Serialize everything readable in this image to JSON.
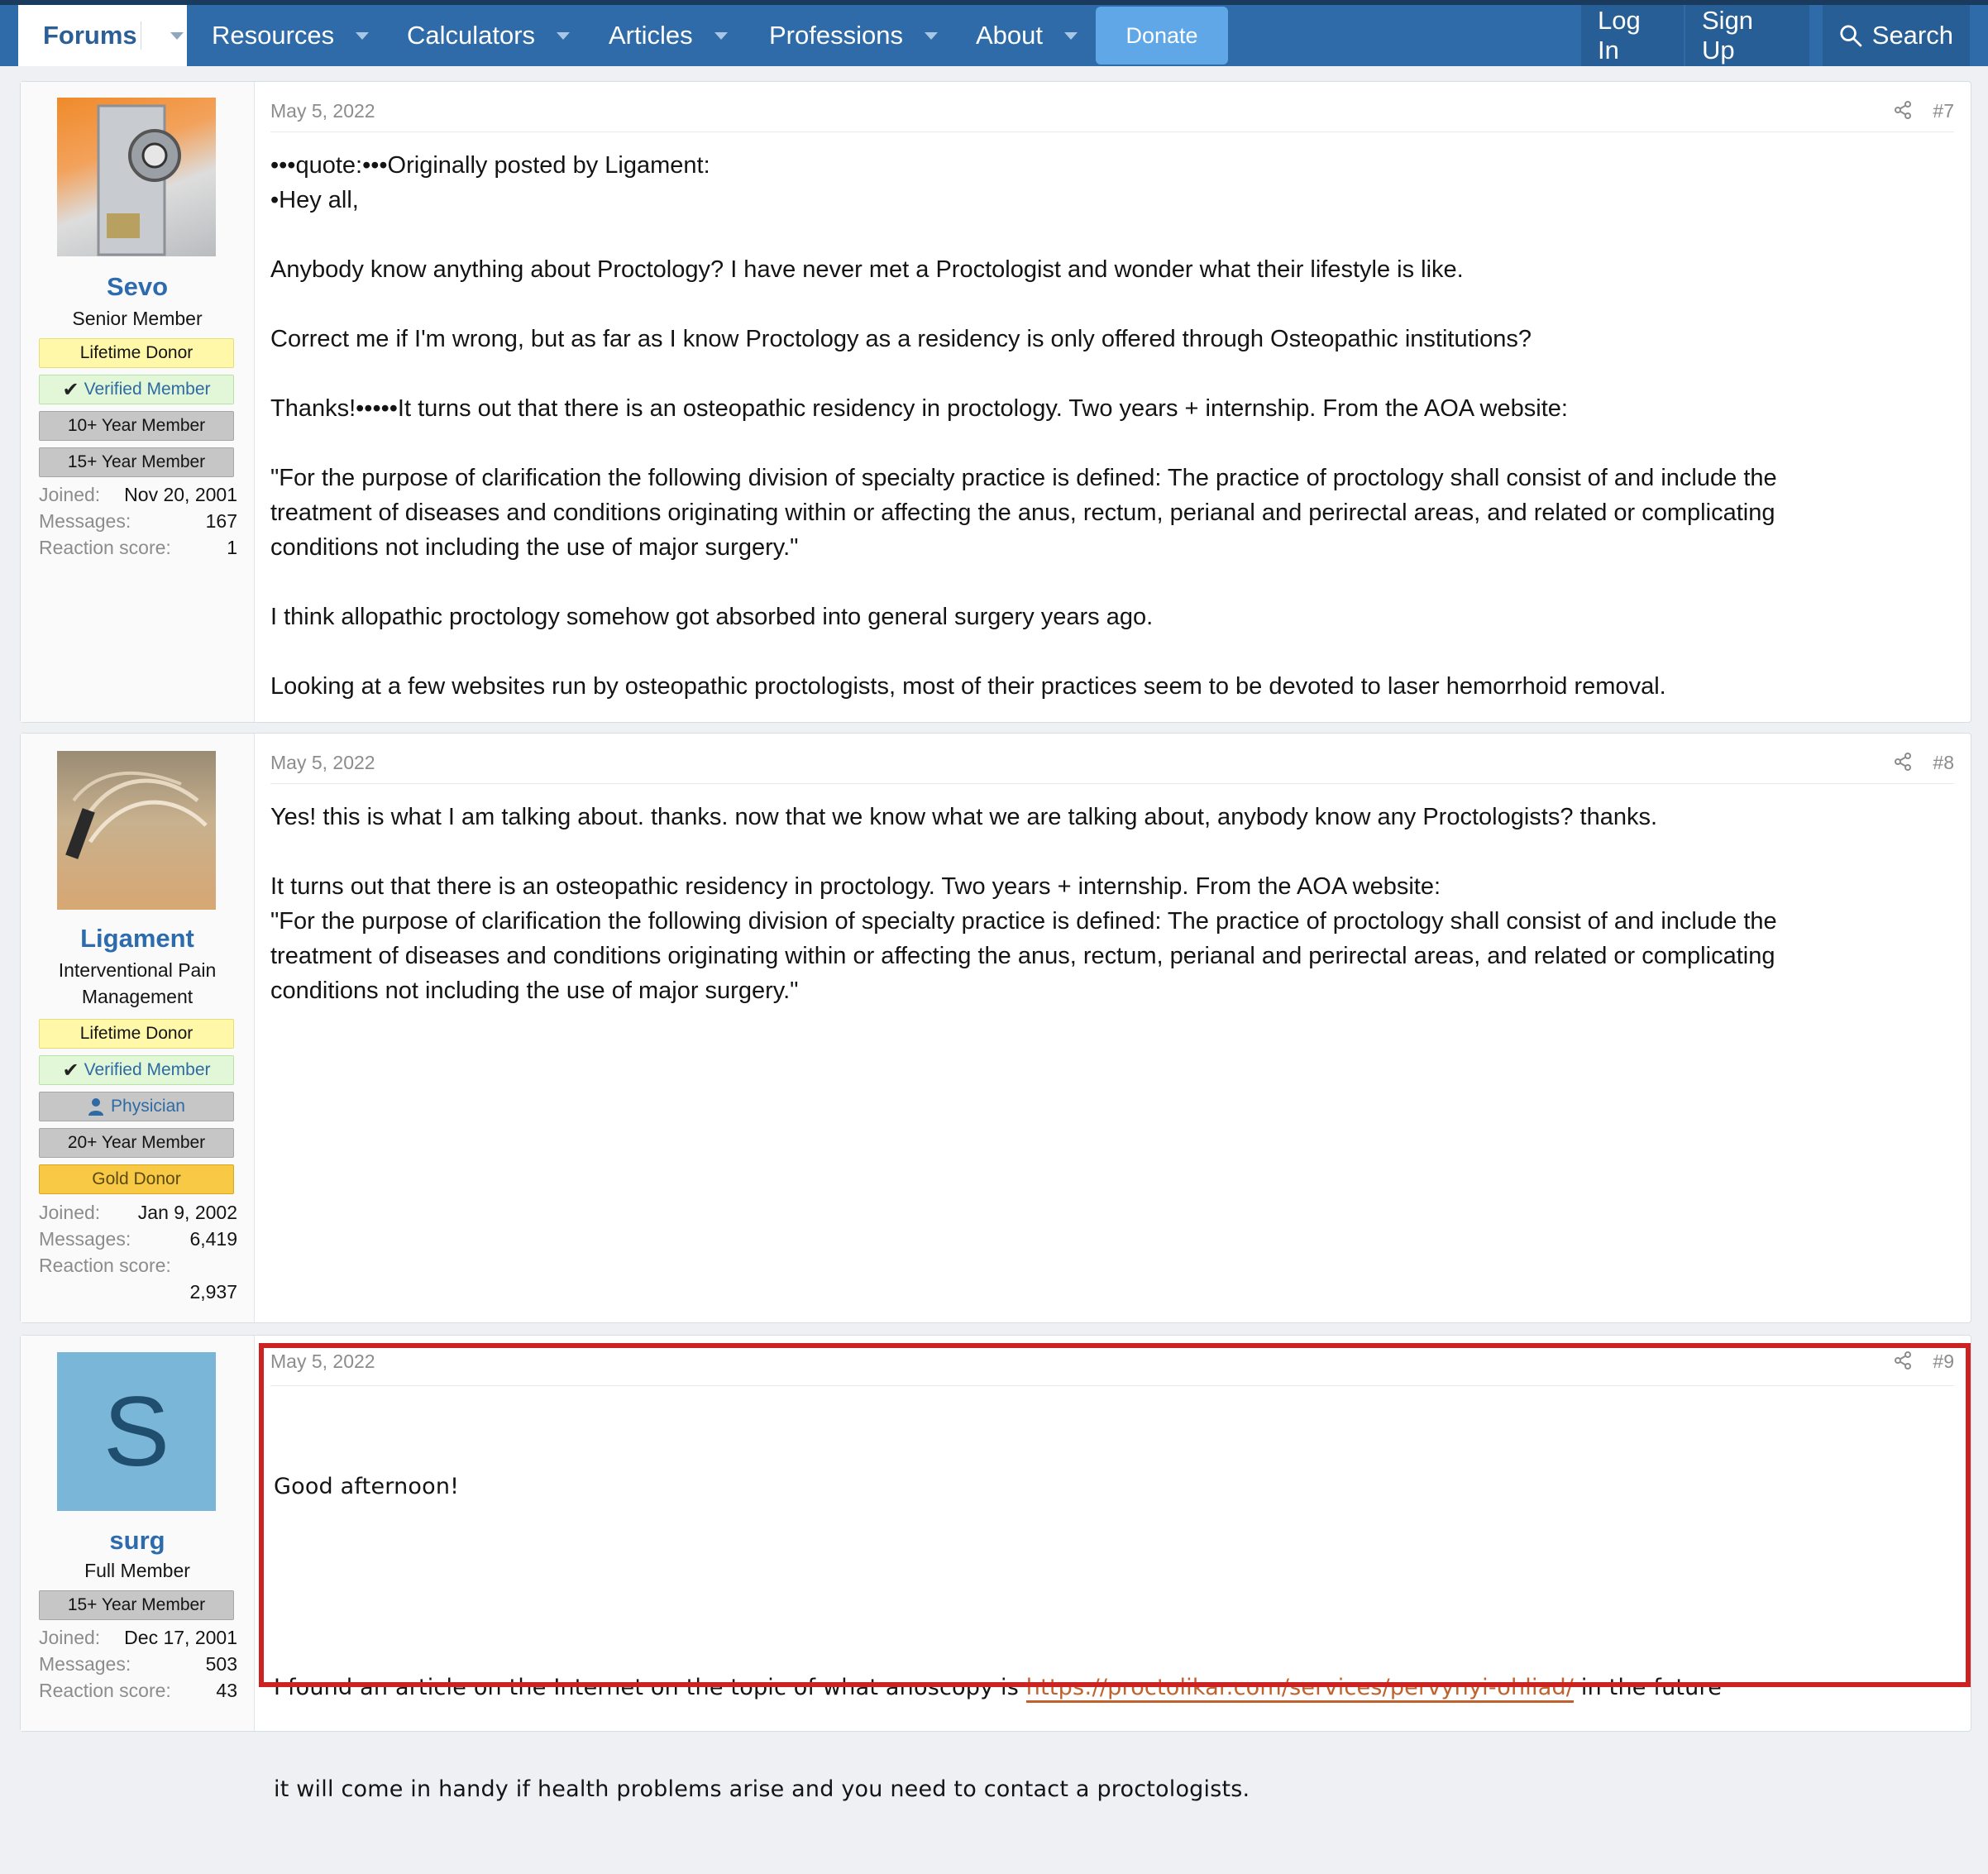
{
  "nav": {
    "forums": "Forums",
    "resources": "Resources",
    "calculators": "Calculators",
    "articles": "Articles",
    "professions": "Professions",
    "about": "About",
    "donate": "Donate",
    "login": "Log In",
    "signup": "Sign Up",
    "search": "Search"
  },
  "posts": [
    {
      "user": {
        "name": "Sevo",
        "title": "Senior Member",
        "badges": [
          "Lifetime Donor",
          "Verified Member",
          "10+ Year Member",
          "15+ Year Member"
        ],
        "joined_label": "Joined:",
        "joined": "Nov 20, 2001",
        "messages_label": "Messages:",
        "messages": "167",
        "reaction_label": "Reaction score:",
        "reaction": "1"
      },
      "date": "May 5, 2022",
      "number": "#7",
      "body": "•••quote:•••Originally posted by Ligament:\n•Hey all,\n\nAnybody know anything about Proctology? I have never met a Proctologist and wonder what their lifestyle is like.\n\nCorrect me if I'm wrong, but as far as I know Proctology as a residency is only offered through Osteopathic institutions?\n\nThanks!•••••It turns out that there is an osteopathic residency in proctology. Two years + internship. From the AOA website:\n\n\"For the purpose of clarification the following division of specialty practice is defined: The practice of proctology shall consist of and include the\ntreatment of diseases and conditions originating within or affecting the anus, rectum, perianal and perirectal areas, and related or complicating\nconditions not including the use of major surgery.\"\n\nI think allopathic proctology somehow got absorbed into general surgery years ago.\n\nLooking at a few websites run by osteopathic proctologists, most of their practices seem to be devoted to laser hemorrhoid removal."
    },
    {
      "user": {
        "name": "Ligament",
        "title": "Interventional Pain Management",
        "badges": [
          "Lifetime Donor",
          "Verified Member",
          "Physician",
          "20+ Year Member",
          "Gold Donor"
        ],
        "joined_label": "Joined:",
        "joined": "Jan 9, 2002",
        "messages_label": "Messages:",
        "messages": "6,419",
        "reaction_label": "Reaction score:",
        "reaction": "2,937"
      },
      "date": "May 5, 2022",
      "number": "#8",
      "body": "Yes! this is what I am talking about. thanks. now that we know what we are talking about, anybody know any Proctologists? thanks.\n\nIt turns out that there is an osteopathic residency in proctology. Two years + internship. From the AOA website:\n\"For the purpose of clarification the following division of specialty practice is defined: The practice of proctology shall consist of and include the\ntreatment of diseases and conditions originating within or affecting the anus, rectum, perianal and perirectal areas, and related or complicating\nconditions not including the use of major surgery.\""
    },
    {
      "user": {
        "name": "surg",
        "avatar_letter": "S",
        "title": "Full Member",
        "badges": [
          "15+ Year Member"
        ],
        "joined_label": "Joined:",
        "joined": "Dec 17, 2001",
        "messages_label": "Messages:",
        "messages": "503",
        "reaction_label": "Reaction score:",
        "reaction": "43"
      },
      "date": "May 5, 2022",
      "number": "#9",
      "greeting": "Good afternoon!",
      "text_before": "I found an article on the Internet on the topic of what anoscopy is ",
      "link": "https://proctolikar.com/services/pervynyi-ohliad/",
      "text_after": " in the future",
      "text_line2": "it will come in handy if health problems arise and you need to contact a proctologists."
    }
  ],
  "colors": {
    "nav_bg": "#2e6ba8",
    "link": "#2d6baf",
    "highlight_border": "#cc2222",
    "spam_link": "#c0622e"
  }
}
